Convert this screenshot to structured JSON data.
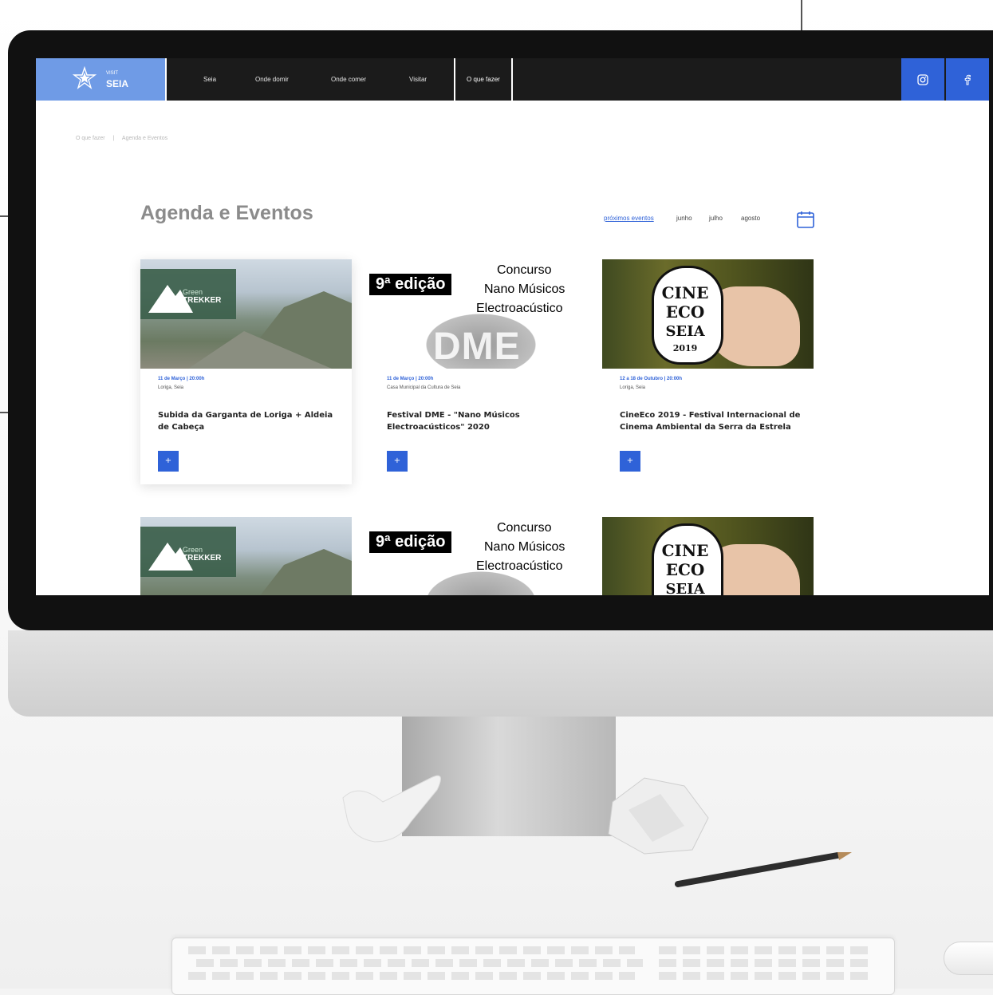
{
  "nav": {
    "logo_visit": "VISIT",
    "logo_seia": "SEIA",
    "items": [
      {
        "label": "Seia"
      },
      {
        "label": "Onde domir"
      },
      {
        "label": "Onde comer"
      },
      {
        "label": "Visitar"
      },
      {
        "label": "O que fazer"
      }
    ],
    "social": [
      {
        "icon": "instagram-icon"
      },
      {
        "icon": "facebook-icon"
      }
    ]
  },
  "breadcrumb": {
    "first": "O que fazer",
    "separator": "|",
    "second": "Agenda e Eventos"
  },
  "page": {
    "title": "Agenda e Eventos",
    "filters": [
      "próximos eventos",
      "junho",
      "julho",
      "agosto"
    ],
    "active_filter": "próximos eventos"
  },
  "cards": [
    {
      "date": "11 de Março | 20:00h",
      "location": "Loriga, Seia",
      "title": "Subida da Garganta de Loriga + Aldeia de Cabeça",
      "button": "+",
      "image_text": [
        "Green",
        "TREKKER"
      ]
    },
    {
      "date": "11 de Março | 20:00h",
      "location": "Casa Municipal da Cultura de Seia",
      "title": "Festival DME - \"Nano Músicos Electroacústicos\" 2020",
      "button": "+",
      "image_text": [
        "9ª edição",
        "Concurso",
        "Nano Músicos",
        "Electroacústico",
        "DME"
      ]
    },
    {
      "date": "12 a 18 de Outubro | 20:00h",
      "location": "Loriga, Seia",
      "title": "CineEco 2019 - Festival Internacional de Cinema Ambiental da Serra da Estrela",
      "button": "+",
      "image_text": [
        "CINE",
        "ECO",
        "SEIA",
        "2019"
      ]
    }
  ],
  "colors": {
    "accent": "#2f62d8",
    "logo_bg": "#6f9be6",
    "nav_bg": "#1b1b1b"
  }
}
